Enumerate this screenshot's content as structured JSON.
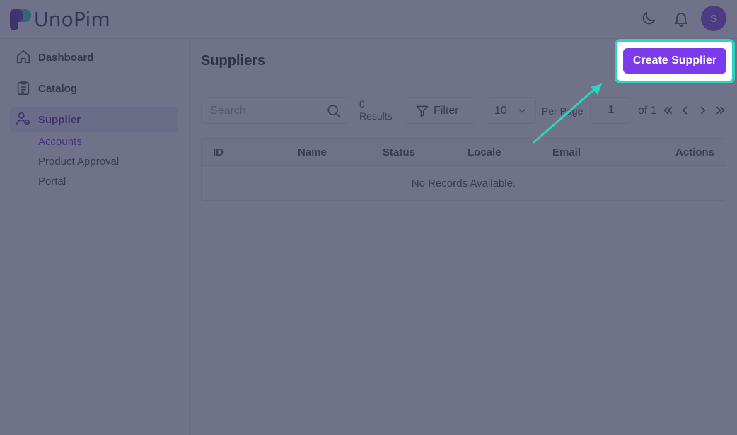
{
  "app": {
    "logo_text": "UnoPim",
    "avatar_initial": "S"
  },
  "header": {
    "theme_icon": "moon-icon",
    "notification_icon": "bell-icon"
  },
  "sidebar": {
    "items": [
      {
        "label": "Dashboard",
        "icon": "home-icon"
      },
      {
        "label": "Catalog",
        "icon": "clipboard-icon"
      },
      {
        "label": "Supplier",
        "icon": "user-settings-icon",
        "active": true
      }
    ],
    "sub_items": [
      {
        "label": "Accounts",
        "active": true
      },
      {
        "label": "Product Approval"
      },
      {
        "label": "Portal"
      }
    ]
  },
  "main": {
    "title": "Suppliers",
    "create_button": "Create Supplier",
    "search_placeholder": "Search",
    "results_count": "0",
    "results_label": "Results",
    "filter_label": "Filter",
    "per_page_value": "10",
    "per_page_label": "Per Page",
    "current_page": "1",
    "of_label": "of 1"
  },
  "table": {
    "columns": [
      "ID",
      "Name",
      "Status",
      "Locale",
      "Email",
      "Actions"
    ],
    "empty_message": "No Records Available."
  },
  "colors": {
    "accent": "#7c3aed",
    "highlight": "#2dd4bf",
    "overlay": "#373c5a"
  }
}
